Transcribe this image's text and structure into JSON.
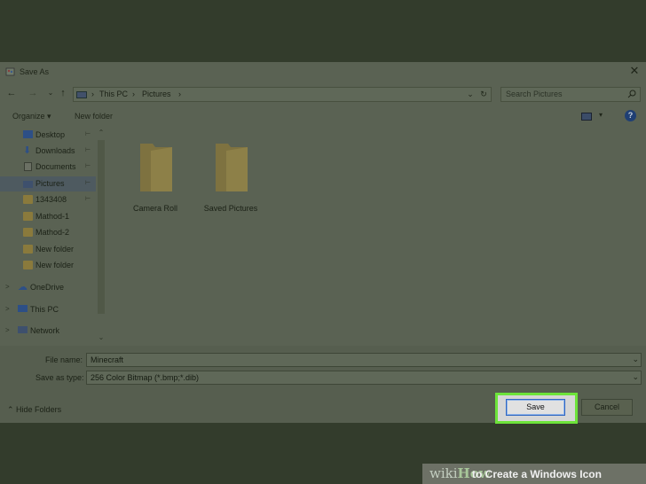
{
  "window": {
    "title": "Save As",
    "close_glyph": "✕"
  },
  "nav": {
    "back_glyph": "←",
    "forward_glyph": "→",
    "up_glyph": "↑",
    "recent_glyph": "⌄",
    "breadcrumb": [
      "This PC",
      "Pictures"
    ],
    "separator": "›",
    "refresh_glyph": "↻",
    "search_placeholder": "Search Pictures"
  },
  "toolbar": {
    "organize_label": "Organize ▾",
    "new_folder_label": "New folder",
    "help_label": "?"
  },
  "sidebar": {
    "items": [
      {
        "label": "Desktop",
        "icon": "desktop-icon",
        "pinned": true
      },
      {
        "label": "Downloads",
        "icon": "download-icon",
        "pinned": true
      },
      {
        "label": "Documents",
        "icon": "documents-icon",
        "pinned": true
      },
      {
        "label": "Pictures",
        "icon": "pictures-icon",
        "pinned": true,
        "selected": true
      },
      {
        "label": "1343408",
        "icon": "folder-icon",
        "pinned": true
      },
      {
        "label": "Mathod-1",
        "icon": "folder-icon"
      },
      {
        "label": "Mathod-2",
        "icon": "folder-icon"
      },
      {
        "label": "New folder",
        "icon": "folder-icon"
      },
      {
        "label": "New folder",
        "icon": "folder-icon"
      },
      {
        "label": "OneDrive",
        "icon": "cloud-icon",
        "expandable": true
      },
      {
        "label": "This PC",
        "icon": "computer-icon",
        "expandable": true
      },
      {
        "label": "Network",
        "icon": "network-icon",
        "expandable": true
      }
    ],
    "pin_glyph": "📌",
    "expand_glyph": ">"
  },
  "content": {
    "folders": [
      {
        "name": "Camera Roll"
      },
      {
        "name": "Saved Pictures"
      }
    ]
  },
  "form": {
    "file_name_label": "File name:",
    "file_name_value": "Minecraft",
    "save_type_label": "Save as type:",
    "save_type_value": "256 Color Bitmap (*.bmp;*.dib)",
    "dropdown_glyph": "⌄"
  },
  "footer": {
    "hide_folders_label": "Hide Folders",
    "save_label": "Save",
    "cancel_label": "Cancel"
  },
  "banner": {
    "wiki": "wiki",
    "how": "How",
    "title_rest": " to Create a Windows Icon"
  },
  "colors": {
    "highlight": "#6de33a",
    "folder": "#8a7a3c",
    "overlay": "#333c2c"
  }
}
